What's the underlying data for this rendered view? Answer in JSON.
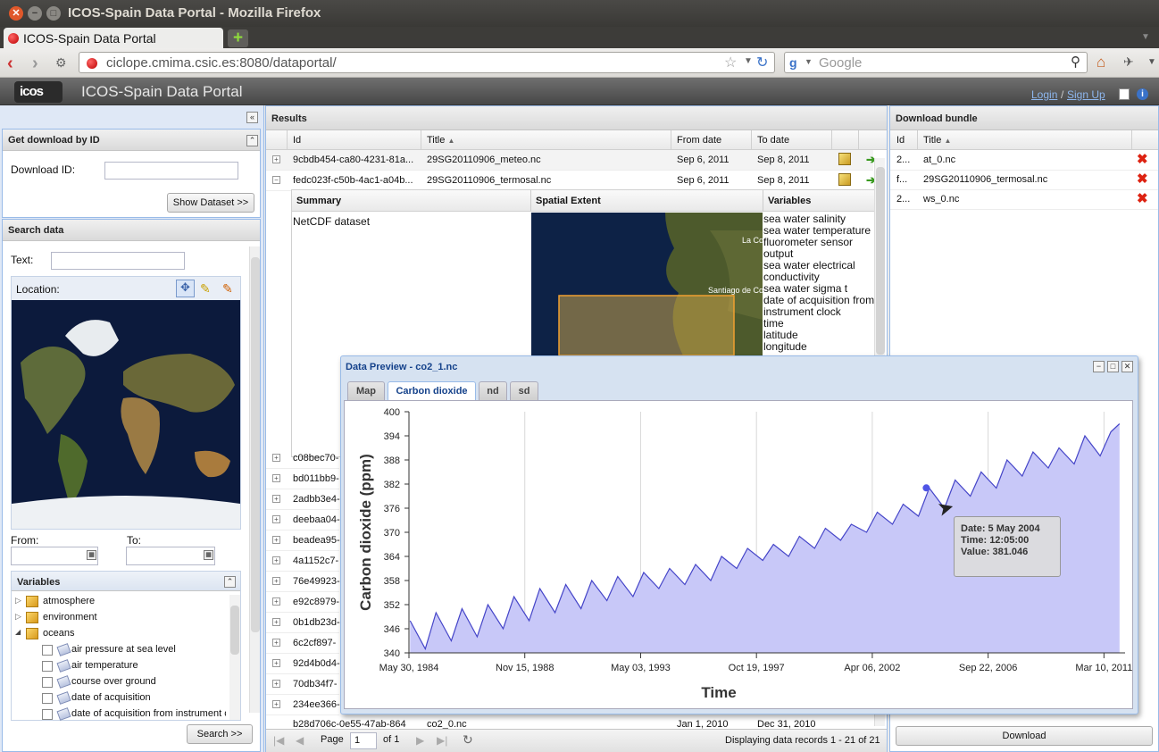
{
  "window": {
    "title": "ICOS-Spain Data Portal - Mozilla Firefox"
  },
  "browser": {
    "tab_label": "ICOS-Spain Data Portal",
    "url": "ciclope.cmima.csic.es:8080/dataportal/",
    "search_placeholder": "Google"
  },
  "app": {
    "logo": "icos",
    "title": "ICOS-Spain Data Portal",
    "login": "Login",
    "signup": "Sign Up",
    "separator": "/"
  },
  "download_by_id": {
    "header": "Get download by ID",
    "label": "Download ID:",
    "value": "",
    "button": "Show Dataset >>"
  },
  "search": {
    "header": "Search data",
    "text_label": "Text:",
    "text_value": "",
    "location_label": "Location:",
    "from_label": "From:",
    "to_label": "To:",
    "button": "Search >>"
  },
  "variables": {
    "header": "Variables",
    "tree": [
      {
        "label": "atmosphere",
        "expander": "▷"
      },
      {
        "label": "environment",
        "expander": "▷"
      },
      {
        "label": "oceans",
        "expander": "◢"
      }
    ],
    "children": [
      "air pressure at sea level",
      "air temperature",
      "course over ground",
      "date of acquisition",
      "date of acquisition from instrument c"
    ]
  },
  "results": {
    "header": "Results",
    "columns": [
      "Id",
      "Title",
      "From date",
      "To date"
    ],
    "rows": [
      {
        "id": "9cbdb454-ca80-4231-81a...",
        "title": "29SG20110906_meteo.nc",
        "from": "Sep 6, 2011",
        "to": "Sep 8, 2011",
        "exp": "+"
      },
      {
        "id": "fedc023f-c50b-4ac1-a04b...",
        "title": "29SG20110906_termosal.nc",
        "from": "Sep 6, 2011",
        "to": "Sep 8, 2011",
        "exp": "−"
      }
    ],
    "detail": {
      "summary_header": "Summary",
      "spatial_header": "Spatial Extent",
      "variables_header": "Variables",
      "summary_text": "NetCDF dataset",
      "map_labels": [
        "La Co",
        "Santiago de Co"
      ],
      "variables": [
        "sea water salinity",
        "sea water temperature",
        "fluorometer sensor",
        "output",
        "sea water electrical",
        "conductivity",
        "sea water sigma t",
        "date of acquisition from",
        "instrument clock",
        "time",
        "latitude",
        "longitude"
      ]
    },
    "collapsed_ids": [
      "c08bec70-",
      "bd011bb9-",
      "2adbb3e4-",
      "deebaa04-",
      "beadea95-",
      "4a1152c7-",
      "76e49923-",
      "e92c8979-",
      "0b1db23d-",
      "6c2cf897-",
      "92d4b0d4-",
      "70db34f7-",
      "234ee366-"
    ],
    "partial_row": {
      "id": "b28d706c-0e55-47ab-864",
      "title": "co2_0.nc",
      "from": "Jan 1, 2010",
      "to": "Dec 31, 2010"
    },
    "pager": {
      "page_label": "Page",
      "page_value": "1",
      "of_label": "of 1",
      "status": "Displaying data records 1 - 21 of 21"
    }
  },
  "bundle": {
    "header": "Download bundle",
    "columns": [
      "Id",
      "Title"
    ],
    "rows": [
      {
        "id": "2...",
        "title": "at_0.nc"
      },
      {
        "id": "f...",
        "title": "29SG20110906_termosal.nc"
      },
      {
        "id": "2...",
        "title": "ws_0.nc"
      }
    ],
    "button": "Download"
  },
  "preview": {
    "title": "Data Preview - co2_1.nc",
    "tabs": [
      "Map",
      "Carbon dioxide",
      "nd",
      "sd"
    ],
    "active_tab": "Carbon dioxide",
    "tooltip": {
      "date": "Date: 5 May 2004",
      "time": "Time: 12:05:00",
      "value": "Value: 381.046"
    }
  },
  "chart_data": {
    "type": "area",
    "title": "",
    "xlabel": "Time",
    "ylabel": "Carbon dioxide (ppm)",
    "xlim": [
      "1984-05-30",
      "2012-01-01"
    ],
    "ylim": [
      340,
      400
    ],
    "x_tick_labels": [
      "May 30, 1984",
      "Nov 15, 1988",
      "May 03, 1993",
      "Oct 19, 1997",
      "Apr 06, 2002",
      "Sep 22, 2006",
      "Mar 10, 2011"
    ],
    "x_ticks": [
      "1984-05-30",
      "1988-11-15",
      "1993-05-03",
      "1997-10-19",
      "2002-04-06",
      "2006-09-22",
      "2011-03-10"
    ],
    "y_ticks": [
      340,
      346,
      352,
      358,
      364,
      370,
      376,
      382,
      388,
      394,
      400
    ],
    "grid": true,
    "fill_color": "#c8c8f8",
    "line_color": "#4545c8",
    "highlight": {
      "x": "2004-05-05",
      "y": 381.046
    },
    "series": [
      {
        "x": [
          "1984-06",
          "1985-01",
          "1985-06",
          "1986-01",
          "1986-06",
          "1987-01",
          "1987-06",
          "1988-01",
          "1988-06",
          "1989-01",
          "1989-06",
          "1990-01",
          "1990-06",
          "1991-01",
          "1991-06",
          "1992-01",
          "1992-06",
          "1993-01",
          "1993-06",
          "1994-01",
          "1994-06",
          "1995-01",
          "1995-06",
          "1996-01",
          "1996-06",
          "1997-01",
          "1997-06",
          "1998-01",
          "1998-06",
          "1999-01",
          "1999-06",
          "2000-01",
          "2000-06",
          "2001-01",
          "2001-06",
          "2002-01",
          "2002-06",
          "2003-01",
          "2003-06",
          "2004-01",
          "2004-06",
          "2005-01",
          "2005-06",
          "2006-01",
          "2006-06",
          "2007-01",
          "2007-06",
          "2008-01",
          "2008-06",
          "2009-01",
          "2009-06",
          "2010-01",
          "2010-06",
          "2011-01",
          "2011-06",
          "2011-10"
        ],
        "y": [
          348,
          341,
          350,
          343,
          351,
          344,
          352,
          346,
          354,
          348,
          356,
          350,
          357,
          351,
          358,
          353,
          359,
          354,
          360,
          356,
          361,
          357,
          362,
          358,
          364,
          361,
          366,
          363,
          367,
          364,
          369,
          366,
          371,
          368,
          372,
          370,
          375,
          372,
          377,
          374,
          381,
          376,
          383,
          379,
          385,
          381,
          388,
          384,
          390,
          386,
          391,
          387,
          394,
          389,
          395,
          397
        ]
      }
    ]
  }
}
